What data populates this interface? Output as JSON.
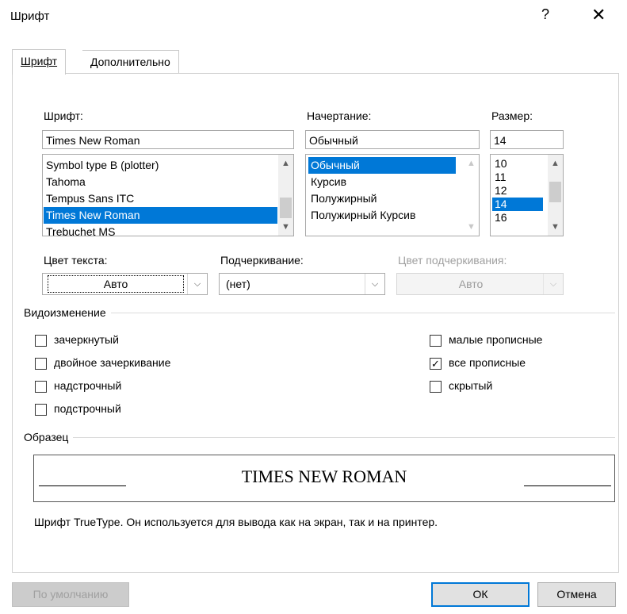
{
  "window": {
    "title": "Шрифт",
    "help_glyph": "?",
    "close_glyph": "✕"
  },
  "tabs": [
    {
      "label": "Шрифт",
      "active": true
    },
    {
      "label": "Дополнительно",
      "active": false
    }
  ],
  "font": {
    "label": "Шрифт:",
    "value": "Times New Roman",
    "items": [
      "Symbol type B (plotter)",
      "Tahoma",
      "Tempus Sans ITC",
      "Times New Roman",
      "Trebuchet MS"
    ],
    "selected_index": 3
  },
  "style": {
    "label": "Начертание:",
    "value": "Обычный",
    "items": [
      "Обычный",
      "Курсив",
      "Полужирный",
      "Полужирный Курсив"
    ],
    "selected_index": 0
  },
  "size": {
    "label": "Размер:",
    "value": "14",
    "items": [
      "10",
      "11",
      "12",
      "14",
      "16"
    ],
    "selected_index": 3
  },
  "text_color": {
    "label": "Цвет текста:",
    "value": "Авто"
  },
  "underline": {
    "label": "Подчеркивание:",
    "value": "(нет)"
  },
  "underline_color": {
    "label": "Цвет подчеркивания:",
    "value": "Авто",
    "disabled": true
  },
  "effects": {
    "label": "Видоизменение",
    "left": [
      {
        "label": "зачеркнутый",
        "checked": false
      },
      {
        "label": "двойное зачеркивание",
        "checked": false
      },
      {
        "label": "надстрочный",
        "checked": false
      },
      {
        "label": "подстрочный",
        "checked": false
      }
    ],
    "right": [
      {
        "label": "малые прописные",
        "checked": false
      },
      {
        "label": "все прописные",
        "checked": true
      },
      {
        "label": "скрытый",
        "checked": false
      }
    ]
  },
  "preview": {
    "label": "Образец",
    "text": "TIMES NEW ROMAN",
    "note": "Шрифт TrueType. Он используется для вывода как на экран, так и на принтер."
  },
  "buttons": {
    "default_label": "По умолчанию",
    "ok_label": "ОК",
    "cancel_label": "Отмена"
  }
}
